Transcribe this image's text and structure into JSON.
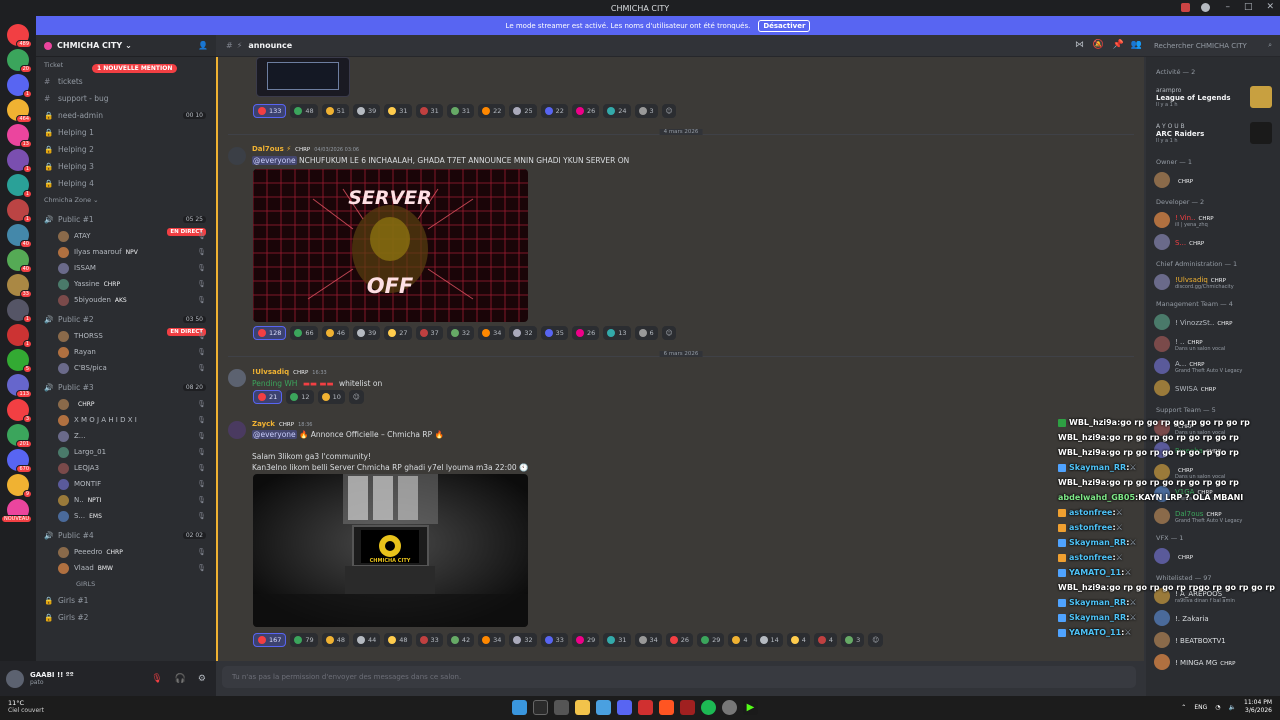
{
  "window": {
    "title": "CHMICHA CITY"
  },
  "banner": {
    "text": "Le mode streamer est activé. Les noms d'utilisateur ont été tronqués.",
    "button": "Désactiver"
  },
  "guild_badges": [
    "489",
    "20",
    "1",
    "464",
    "13",
    "1",
    "1",
    "1",
    "40",
    "40",
    "33",
    "1",
    "1",
    "5",
    "113",
    "3",
    "201",
    "670",
    "9",
    "NOUVEAU"
  ],
  "server": {
    "name": "CHMICHA CITY",
    "new_mention": "1 NOUVELLE MENTION",
    "cat_ticket": "Ticket",
    "ticket_channels": [
      "tickets",
      "support - bug",
      "need-admin",
      "Helping 1",
      "Helping 2",
      "Helping 3",
      "Helping 4"
    ],
    "need_admin_count": "00 10",
    "cat_zone": "Chmicha Zone",
    "public1": {
      "name": "Public #1",
      "count": "05 25",
      "live": "EN DIRECT",
      "users": [
        {
          "name": "ATAY",
          "tag": ""
        },
        {
          "name": "Ilyas maarouf",
          "tag": "NPV"
        },
        {
          "name": "ISSAM",
          "tag": ""
        },
        {
          "name": "Yassine",
          "tag": "CHRP"
        },
        {
          "name": "5biyouden",
          "tag": "AKS"
        }
      ]
    },
    "public2": {
      "name": "Public #2",
      "count": "03 50",
      "live": "EN DIRECT",
      "users": [
        {
          "name": "THORSS",
          "tag": ""
        },
        {
          "name": "Rayan",
          "tag": ""
        },
        {
          "name": "C'BS/pica",
          "tag": ""
        }
      ]
    },
    "public3": {
      "name": "Public #3",
      "count": "08 20",
      "users": [
        {
          "name": "",
          "tag": "CHRP"
        },
        {
          "name": "X M O J A H I D X I",
          "tag": ""
        },
        {
          "name": "Z...",
          "tag": ""
        },
        {
          "name": "Largo_01",
          "tag": ""
        },
        {
          "name": "LEQJA3",
          "tag": ""
        },
        {
          "name": "MONTIF",
          "tag": ""
        },
        {
          "name": "N..",
          "tag": "NPTI"
        },
        {
          "name": "S...",
          "tag": "EMS"
        }
      ]
    },
    "public4": {
      "name": "Public #4",
      "count": "02 02",
      "users": [
        {
          "name": "Peeedro",
          "tag": "CHRP"
        },
        {
          "name": "Vlaad",
          "tag": "BMW"
        }
      ]
    },
    "cat_girls": "GIRLS",
    "girls": [
      "Girls #1",
      "Girls #2"
    ]
  },
  "user_panel": {
    "name": "GAABI !! ºº",
    "status": "pato"
  },
  "channel": {
    "name": "announce"
  },
  "search_placeholder": "Rechercher CHMICHA CITY",
  "messages": {
    "top_reacts": [
      "133",
      "48",
      "51",
      "39",
      "31",
      "31",
      "31",
      "22",
      "25",
      "22",
      "26",
      "24",
      "3"
    ],
    "date1": "4 mars 2026",
    "m1": {
      "user": "Dal7ous",
      "role": "CHRP",
      "time": "04/03/2026 03:06",
      "mention": "@everyone",
      "text": "NCHUFUKUM LE 6 INCHAALAH, GHADA T7ET ANNOUNCE MNIN GHADI YKUN SERVER ON",
      "image_top": "SERVER",
      "image_bottom": "OFF",
      "reacts": [
        "128",
        "66",
        "46",
        "39",
        "27",
        "37",
        "32",
        "34",
        "32",
        "35",
        "26",
        "13",
        "6"
      ]
    },
    "date2": "6 mars 2026",
    "m2": {
      "user": "!Ulvsadiq",
      "role": "CHRP",
      "time": "16:33",
      "pending": "Pending WH",
      "text": "whitelist on",
      "reacts": [
        "21",
        "12",
        "10"
      ]
    },
    "m3": {
      "user": "Zayck",
      "role": "CHRP",
      "time": "18:36",
      "mention": "@everyone",
      "headline": "Annonce Officielle – Chmicha RP",
      "line1": "Salam 3likom ga3 l'community!",
      "line2": "Kan3elno likom belli Server Chmicha RP ghadi y7el lyouma m3a 22:00",
      "logo": "CHMICHA CITY",
      "reacts": [
        "167",
        "79",
        "48",
        "44",
        "48",
        "33",
        "42",
        "34",
        "32",
        "33",
        "29",
        "31",
        "34",
        "26",
        "29",
        "4",
        "14",
        "4",
        "4",
        "3"
      ]
    }
  },
  "composer_placeholder": "Tu n'as pas la permission d'envoyer des messages dans ce salon.",
  "members": {
    "activity_header": "Activité — 2",
    "activities": [
      {
        "user": "arampro",
        "game": "League of Legends",
        "time": "Il y a 1 h"
      },
      {
        "user": "A Y O U B",
        "game": "ARC Raiders",
        "time": "Il y a 1 h"
      }
    ],
    "groups": [
      {
        "name": "Owner — 1",
        "members": [
          {
            "name": "",
            "tag": "CHRP",
            "sub": ""
          }
        ]
      },
      {
        "name": "Developer — 2",
        "members": [
          {
            "name": "! Vin..",
            "tag": "CHRP",
            "sub": "ill | yena_zhq"
          },
          {
            "name": "S...",
            "tag": "CHRP",
            "sub": ""
          }
        ]
      },
      {
        "name": "Chief Administration — 1",
        "members": [
          {
            "name": "!Ulvsadiq",
            "tag": "CHRP",
            "sub": "discord.gg/Chmichacity"
          }
        ]
      },
      {
        "name": "Management Team — 4",
        "members": [
          {
            "name": "! VinozzSt..",
            "tag": "CHRP",
            "sub": ""
          },
          {
            "name": "! ..",
            "tag": "CHRP",
            "sub": "Dans un salon vocal"
          },
          {
            "name": "A...",
            "tag": "CHRP",
            "sub": "Grand Theft Auto V Legacy"
          },
          {
            "name": "SWISA",
            "tag": "CHRP",
            "sub": ""
          }
        ]
      },
      {
        "name": "Support Team — 5",
        "members": [
          {
            "name": "",
            "tag": "CHRP",
            "sub": "Dans un salon vocal"
          },
          {
            "name": "Rweeha",
            "tag": "CHRP",
            "sub": ""
          },
          {
            "name": "",
            "tag": "CHRP",
            "sub": "Dans un salon vocal"
          },
          {
            "name": "V1GA",
            "tag": "CHRP",
            "sub": "Even a broken clock is ri..."
          },
          {
            "name": "Dal7ous",
            "tag": "CHRP",
            "sub": "Grand Theft Auto V Legacy"
          }
        ]
      },
      {
        "name": "VFX — 1",
        "members": [
          {
            "name": "",
            "tag": "CHRP",
            "sub": ""
          }
        ]
      },
      {
        "name": "Whitelisted — 97",
        "members": [
          {
            "name": "! A_AREPOOS_",
            "tag": "",
            "sub": "ra9tiva dinan f bal amin"
          },
          {
            "name": "!. Zakaria",
            "tag": "",
            "sub": ""
          },
          {
            "name": "! BEATBOXTV1",
            "tag": "",
            "sub": ""
          },
          {
            "name": "! MINGA MG",
            "tag": "CHRP",
            "sub": ""
          }
        ]
      }
    ]
  },
  "stream_chat": [
    {
      "user": "WBL_hzi9a",
      "msg": "go rp go rp go rp go rp go rp",
      "color": "#ffffff",
      "badge": "#2ea043"
    },
    {
      "user": "WBL_hzi9a",
      "msg": "go rp go rp go rp go rp go rp",
      "color": "#ffffff",
      "badge": ""
    },
    {
      "user": "WBL_hzi9a",
      "msg": "go rp go rp go rp go rp go rp",
      "color": "#ffffff",
      "badge": ""
    },
    {
      "user": "Skayman_RR",
      "msg": "",
      "color": "#4fc3f7",
      "badge": "#4fa3ff"
    },
    {
      "user": "WBL_hzi9a",
      "msg": "go rp go rp go rp go rp go rp",
      "color": "#ffffff",
      "badge": ""
    },
    {
      "user": "abdelwahd_GB05",
      "msg": "KAYN LRP ? OLA MBANI",
      "color": "#7ee787",
      "badge": ""
    },
    {
      "user": "astonfree",
      "msg": "",
      "color": "#4fc3f7",
      "badge": "#f0a030"
    },
    {
      "user": "astonfree",
      "msg": "",
      "color": "#4fc3f7",
      "badge": "#f0a030"
    },
    {
      "user": "Skayman_RR",
      "msg": "",
      "color": "#4fc3f7",
      "badge": "#4fa3ff"
    },
    {
      "user": "astonfree",
      "msg": "",
      "color": "#4fc3f7",
      "badge": "#f0a030"
    },
    {
      "user": "YAMATO_11",
      "msg": "",
      "color": "#4fc3f7",
      "badge": "#4fa3ff"
    },
    {
      "user": "WBL_hzi9a",
      "msg": "go rp go rp go rp rpgo rp go rp go rp",
      "color": "#ffffff",
      "badge": ""
    },
    {
      "user": "Skayman_RR",
      "msg": "",
      "color": "#4fc3f7",
      "badge": "#4fa3ff"
    },
    {
      "user": "Skayman_RR",
      "msg": "",
      "color": "#4fc3f7",
      "badge": "#4fa3ff"
    },
    {
      "user": "YAMATO_11",
      "msg": "",
      "color": "#4fc3f7",
      "badge": "#4fa3ff"
    }
  ],
  "taskbar": {
    "temp": "11°C",
    "weather": "Ciel couvert",
    "lang": "ENG",
    "time": "11:04 PM",
    "date": "3/6/2026"
  }
}
